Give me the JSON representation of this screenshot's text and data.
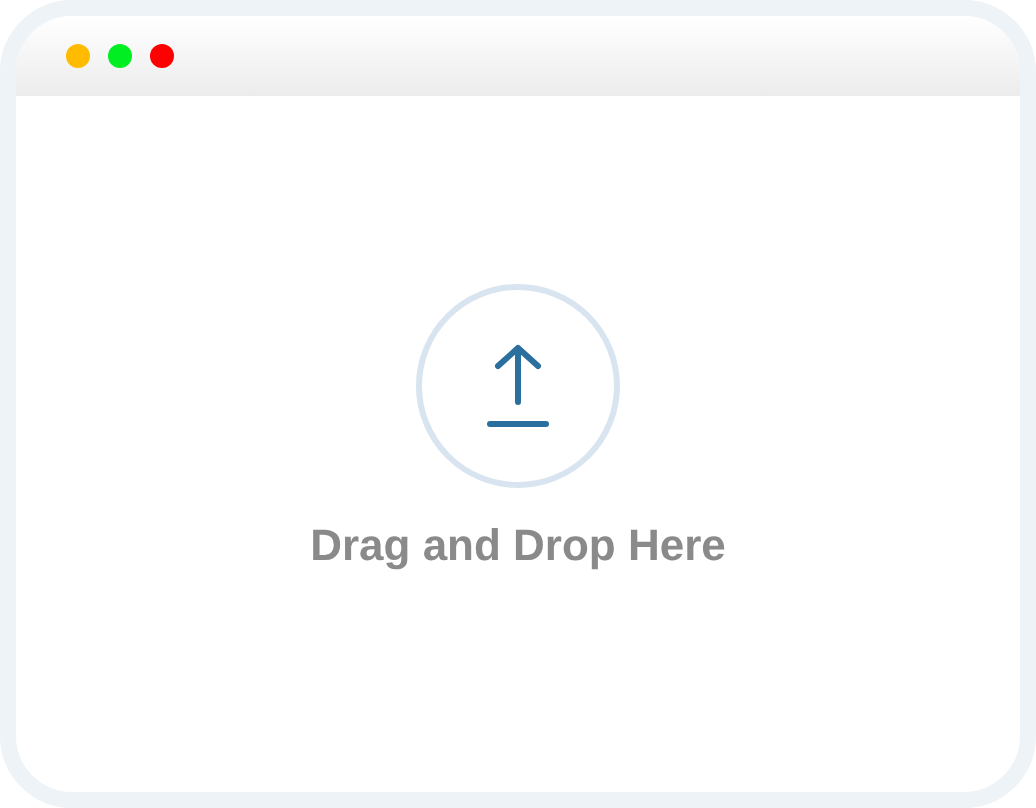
{
  "window": {
    "controls": [
      {
        "color": "#ffbb00"
      },
      {
        "color": "#00ee22"
      },
      {
        "color": "#ff0000"
      }
    ]
  },
  "drop_zone": {
    "label": "Drag and Drop Here"
  }
}
